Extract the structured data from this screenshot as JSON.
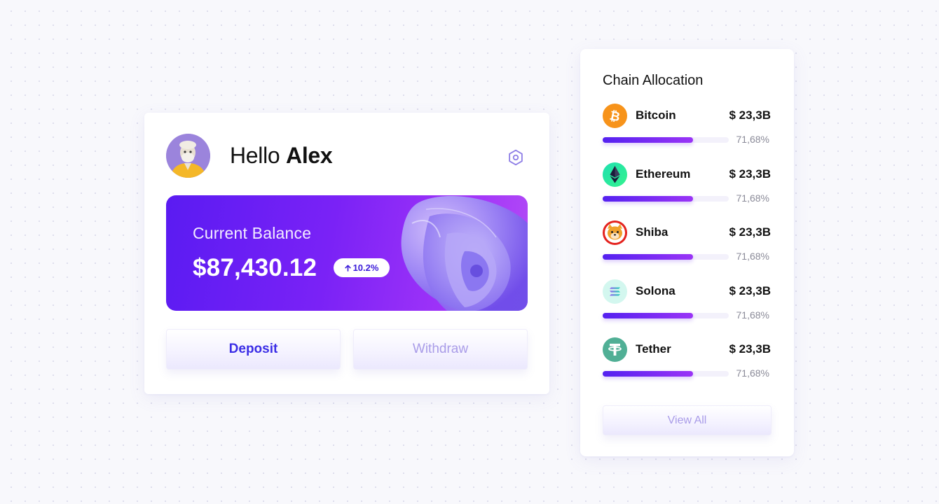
{
  "greeting": {
    "prefix": "Hello",
    "name": "Alex"
  },
  "icons": {
    "avatar": "user-avatar",
    "settings": "gear-icon",
    "change": "arrow-up-icon"
  },
  "balance": {
    "label": "Current Balance",
    "amount": "$87,430.12",
    "change": "10.2%"
  },
  "actions": {
    "deposit": "Deposit",
    "withdraw": "Withdraw"
  },
  "colors": {
    "accent": "#5a1bf2",
    "accent_end": "#b44cf6",
    "button_text": "#3b2ee6",
    "muted_button_text": "#a99ce8"
  },
  "chain": {
    "title": "Chain Allocation",
    "coins": [
      {
        "name": "Bitcoin",
        "value": "$ 23,3B",
        "percent": "71,68%",
        "share": 0.7168,
        "icon": "bitcoin-icon",
        "color": "#f7931a"
      },
      {
        "name": "Ethereum",
        "value": "$ 23,3B",
        "percent": "71,68%",
        "share": 0.7168,
        "icon": "ethereum-icon",
        "color": "#2ee8a0"
      },
      {
        "name": "Shiba",
        "value": "$ 23,3B",
        "percent": "71,68%",
        "share": 0.7168,
        "icon": "shiba-icon",
        "color": "#e4231f"
      },
      {
        "name": "Solona",
        "value": "$ 23,3B",
        "percent": "71,68%",
        "share": 0.7168,
        "icon": "solana-icon",
        "color": "#c9f5ec"
      },
      {
        "name": "Tether",
        "value": "$ 23,3B",
        "percent": "71,68%",
        "share": 0.7168,
        "icon": "tether-icon",
        "color": "#50af95"
      }
    ],
    "view_all": "View All"
  }
}
